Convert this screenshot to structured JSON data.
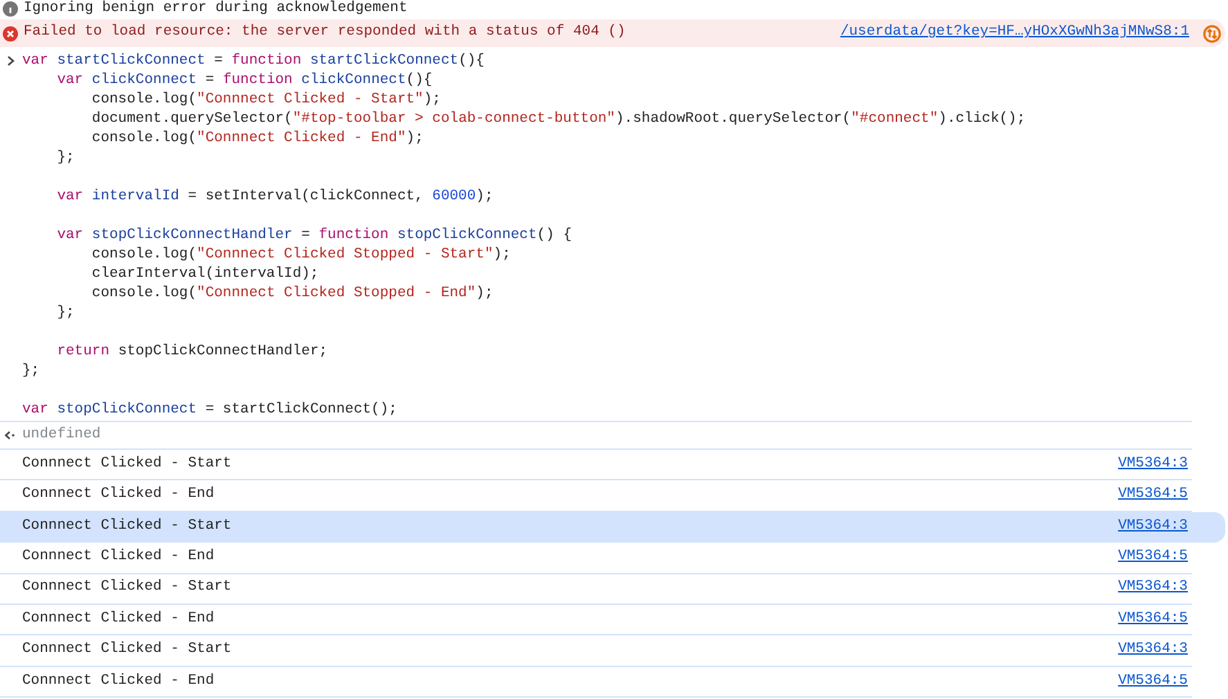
{
  "info_message": {
    "text": "Ignoring benign error during acknowledgement"
  },
  "error_message": {
    "text": "Failed to load resource: the server responded with a status of 404 ()",
    "source": "/userdata/get?key=HF…yHOxXGwNh3ajMNwS8:1"
  },
  "input_code": [
    [
      [
        {
          "kind": "keyword",
          "text": "var"
        },
        {
          "kind": "name",
          "text": " startClickConnect"
        },
        {
          "kind": "plain",
          "text": " = "
        },
        {
          "kind": "keyword",
          "text": "function"
        },
        {
          "kind": "name",
          "text": " startClickConnect"
        },
        {
          "kind": "plain",
          "text": "(){"
        }
      ],
      [
        {
          "kind": "keyword",
          "text": "    var"
        },
        {
          "kind": "name",
          "text": " clickConnect"
        },
        {
          "kind": "plain",
          "text": " = "
        },
        {
          "kind": "keyword",
          "text": "function"
        },
        {
          "kind": "name",
          "text": " clickConnect"
        },
        {
          "kind": "plain",
          "text": "(){"
        }
      ],
      [
        {
          "kind": "plain",
          "text": "        console.log("
        },
        {
          "kind": "string",
          "text": "\"Connnect Clicked - Start\""
        },
        {
          "kind": "plain",
          "text": ");"
        }
      ],
      [
        {
          "kind": "plain",
          "text": "        document.querySelector("
        },
        {
          "kind": "string",
          "text": "\"#top-toolbar > colab-connect-button\""
        },
        {
          "kind": "plain",
          "text": ").shadowRoot.querySelector("
        },
        {
          "kind": "string",
          "text": "\"#connect\""
        },
        {
          "kind": "plain",
          "text": ").click();"
        }
      ],
      [
        {
          "kind": "plain",
          "text": "        console.log("
        },
        {
          "kind": "string",
          "text": "\"Connnect Clicked - End\""
        },
        {
          "kind": "plain",
          "text": ");"
        }
      ],
      [
        {
          "kind": "plain",
          "text": "    };"
        }
      ]
    ],
    [
      [
        {
          "kind": "keyword",
          "text": "    var"
        },
        {
          "kind": "name",
          "text": " intervalId"
        },
        {
          "kind": "plain",
          "text": " = setInterval(clickConnect, "
        },
        {
          "kind": "number",
          "text": "60000"
        },
        {
          "kind": "plain",
          "text": ");"
        }
      ]
    ],
    [
      [
        {
          "kind": "keyword",
          "text": "    var"
        },
        {
          "kind": "name",
          "text": " stopClickConnectHandler"
        },
        {
          "kind": "plain",
          "text": " = "
        },
        {
          "kind": "keyword",
          "text": "function"
        },
        {
          "kind": "name",
          "text": " stopClickConnect"
        },
        {
          "kind": "plain",
          "text": "() {"
        }
      ],
      [
        {
          "kind": "plain",
          "text": "        console.log("
        },
        {
          "kind": "string",
          "text": "\"Connnect Clicked Stopped - Start\""
        },
        {
          "kind": "plain",
          "text": ");"
        }
      ],
      [
        {
          "kind": "plain",
          "text": "        clearInterval(intervalId);"
        }
      ],
      [
        {
          "kind": "plain",
          "text": "        console.log("
        },
        {
          "kind": "string",
          "text": "\"Connnect Clicked Stopped - End\""
        },
        {
          "kind": "plain",
          "text": ");"
        }
      ],
      [
        {
          "kind": "plain",
          "text": "    };"
        }
      ]
    ],
    [
      [
        {
          "kind": "keyword",
          "text": "    return"
        },
        {
          "kind": "plain",
          "text": " stopClickConnectHandler;"
        }
      ],
      [
        {
          "kind": "plain",
          "text": "};"
        }
      ]
    ],
    [
      [
        {
          "kind": "keyword",
          "text": "var"
        },
        {
          "kind": "name",
          "text": " stopClickConnect"
        },
        {
          "kind": "plain",
          "text": " = startClickConnect();"
        }
      ]
    ]
  ],
  "result": {
    "text": "undefined"
  },
  "log_rows": [
    {
      "text": "Connnect Clicked - Start",
      "source": "VM5364:3",
      "selected": false
    },
    {
      "text": "Connnect Clicked - End",
      "source": "VM5364:5",
      "selected": false
    },
    {
      "text": "Connnect Clicked - Start",
      "source": "VM5364:3",
      "selected": true
    },
    {
      "text": "Connnect Clicked - End",
      "source": "VM5364:5",
      "selected": false
    },
    {
      "text": "Connnect Clicked - Start",
      "source": "VM5364:3",
      "selected": false
    },
    {
      "text": "Connnect Clicked - End",
      "source": "VM5364:5",
      "selected": false
    },
    {
      "text": "Connnect Clicked - Start",
      "source": "VM5364:3",
      "selected": false
    },
    {
      "text": "Connnect Clicked - End",
      "source": "VM5364:5",
      "selected": false
    }
  ]
}
